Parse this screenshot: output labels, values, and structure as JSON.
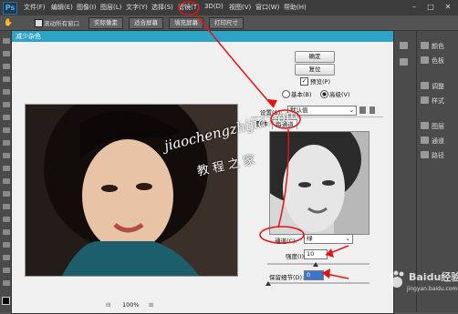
{
  "app": {
    "logo": "Ps",
    "menu": [
      "文件(F)",
      "编辑(E)",
      "图像(I)",
      "图层(L)",
      "文字(Y)",
      "选择(S)",
      "滤镜(T)",
      "3D(D)",
      "视图(V)",
      "窗口(W)",
      "帮助(H)"
    ],
    "window_controls": [
      "–",
      "□",
      "✕"
    ]
  },
  "options_bar": {
    "checkbox_label": "滚动所有窗口",
    "buttons": [
      "实际像素",
      "适合屏幕",
      "填充屏幕",
      "打印尺寸"
    ]
  },
  "right_panel": {
    "items": [
      "颜色",
      "色板",
      "调整",
      "样式",
      "图层",
      "通道",
      "路径"
    ]
  },
  "dialog": {
    "title": "减少杂色",
    "ok_label": "确定",
    "reset_label": "复位",
    "preview_label": "预览(P)",
    "mode_basic": "基本(B)",
    "mode_advanced": "高级(V)",
    "settings_label": "设置(S):",
    "settings_value": "默认值",
    "tab_overall": "整体",
    "tab_per_channel": "每通道",
    "channel_label": "通道(C):",
    "channel_value": "绿",
    "strength_label": "强度(I):",
    "strength_value": "10",
    "detail_label": "保留细节(D):",
    "detail_value": "0",
    "percent": "%",
    "zoom_minus": "⊟",
    "zoom_level": "100%",
    "zoom_plus": "⊞"
  },
  "watermark": {
    "line1": "jiaochengzhijia.com",
    "line2": "教 程 之 家",
    "brand": "Baidu经验",
    "brand_sub": "jingyan.baidu.com"
  },
  "colors": {
    "accent_title": "#2fa3c5",
    "annotation_red": "#e01515"
  }
}
